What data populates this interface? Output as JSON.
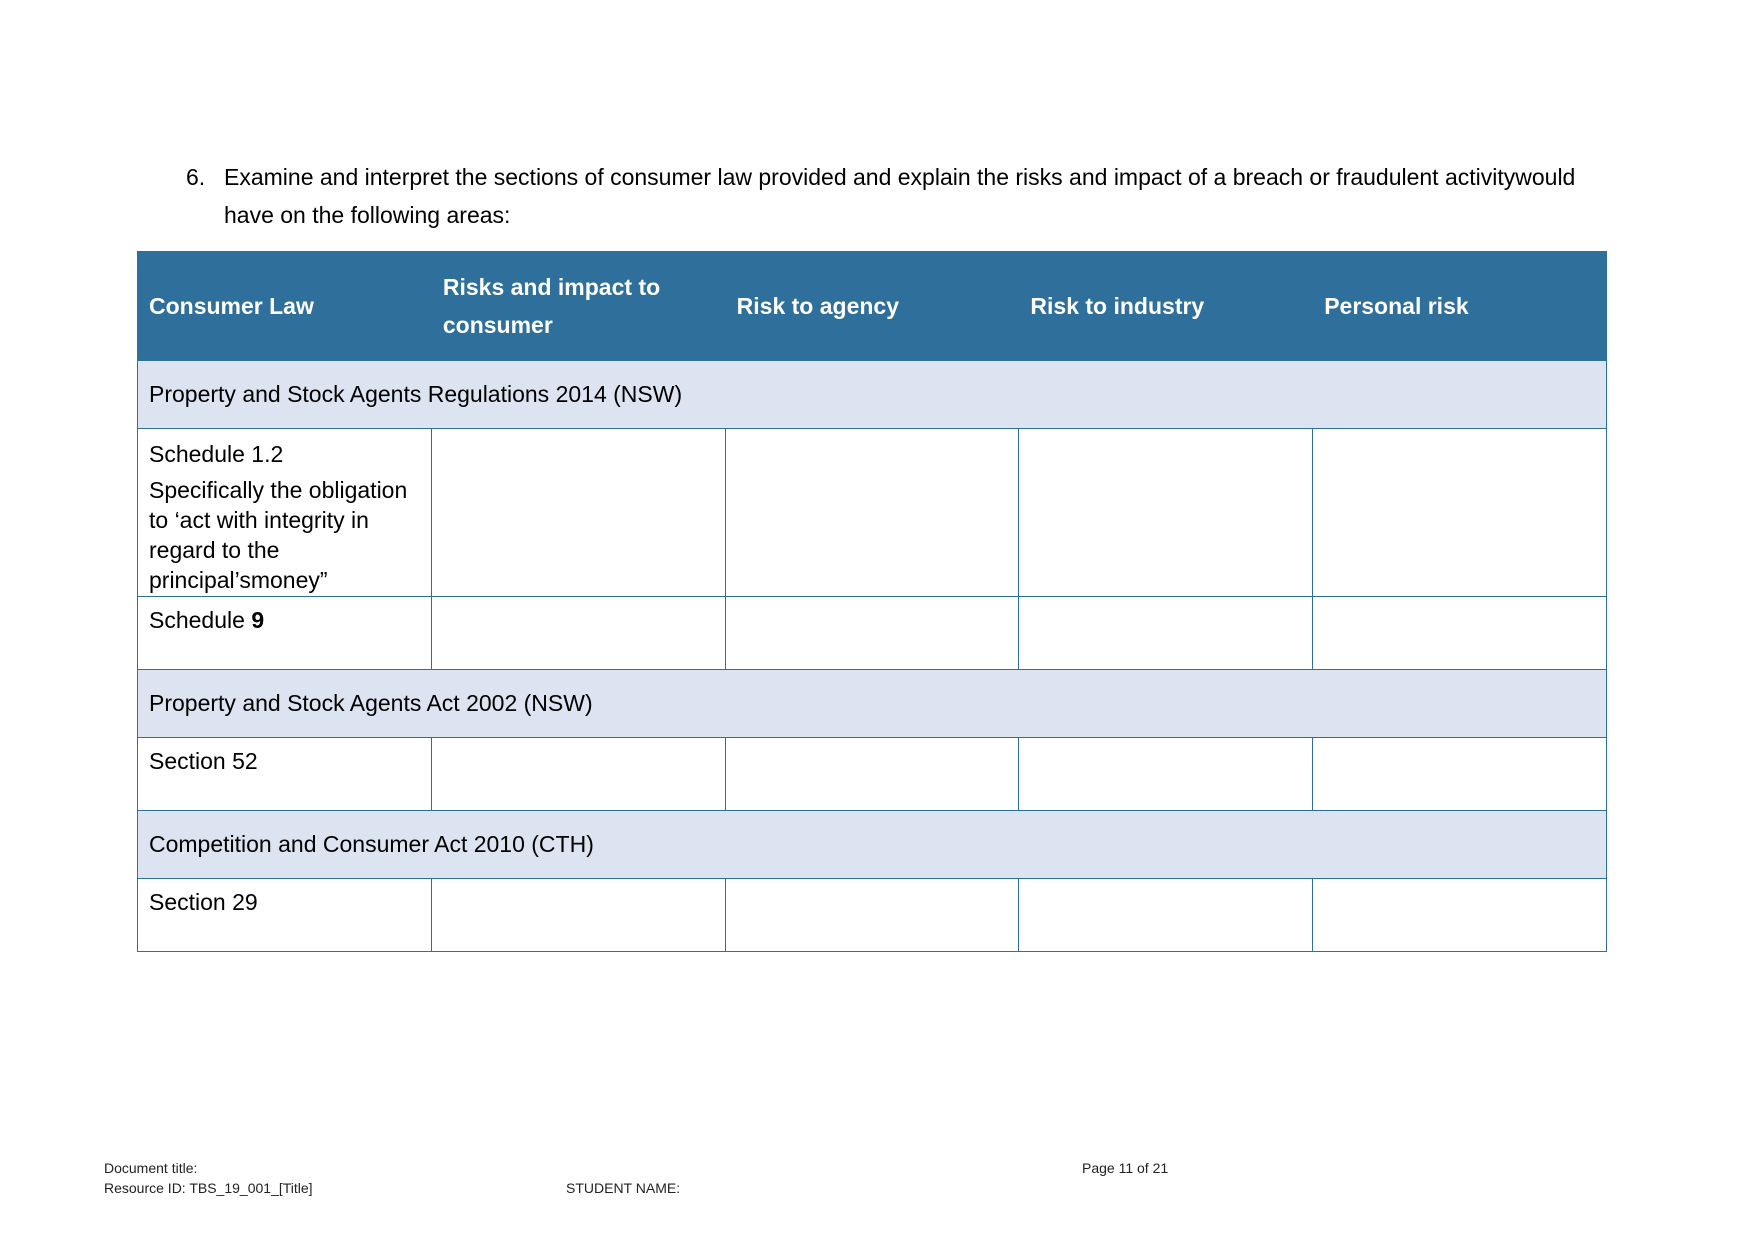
{
  "question": {
    "number": "6.",
    "text": "Examine and interpret the sections of consumer law provided and explain the risks and impact of a breach or fraudulent activitywould have on the following areas:"
  },
  "table": {
    "headers": [
      "Consumer Law",
      "Risks and impact to consumer",
      "Risk to agency",
      "Risk to industry",
      "Personal risk"
    ],
    "groups": [
      {
        "title": "Property and Stock Agents Regulations 2014 (NSW)",
        "rows": [
          {
            "law_title": "Schedule 1.2",
            "law_detail": "Specifically the obligation to  ‘act with integrity in regard to the principal’smoney”",
            "cells": [
              "",
              "",
              "",
              ""
            ]
          },
          {
            "law_prefix": "Schedule ",
            "law_bold": "9",
            "cells": [
              "",
              "",
              "",
              ""
            ]
          }
        ]
      },
      {
        "title": "Property and Stock Agents Act 2002 (NSW)",
        "rows": [
          {
            "law_title": "Section 52",
            "cells": [
              "",
              "",
              "",
              ""
            ]
          }
        ]
      },
      {
        "title": "Competition and Consumer Act 2010 (CTH)",
        "rows": [
          {
            "law_title": "Section 29",
            "cells": [
              "",
              "",
              "",
              ""
            ]
          }
        ]
      }
    ]
  },
  "footer": {
    "document_title": "Document title:",
    "resource_id": "Resource ID: TBS_19_001_[Title]",
    "student_name": "STUDENT NAME:",
    "page": "Page 11 of 21"
  },
  "colors": {
    "header_bg": "#2e6f9c",
    "group_bg": "#dbe4f0"
  }
}
